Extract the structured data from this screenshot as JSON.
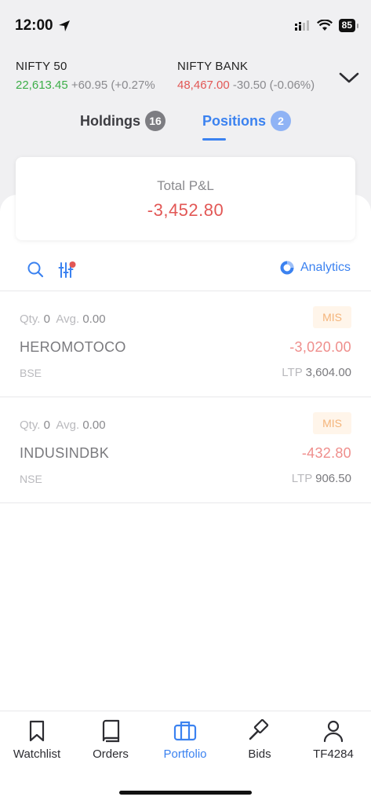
{
  "status_bar": {
    "time": "12:00",
    "battery": "85"
  },
  "indices": [
    {
      "name": "NIFTY 50",
      "value": "22,613.45",
      "change": "+60.95",
      "change_pct": "(+0.27%",
      "direction": "up"
    },
    {
      "name": "NIFTY BANK",
      "value": "48,467.00",
      "change": "-30.50",
      "change_pct": "(-0.06%)",
      "direction": "down"
    }
  ],
  "tabs": [
    {
      "label": "Holdings",
      "count": "16",
      "active": false
    },
    {
      "label": "Positions",
      "count": "2",
      "active": true
    }
  ],
  "pnl": {
    "label": "Total P&L",
    "value": "-3,452.80"
  },
  "toolbar": {
    "analytics_label": "Analytics"
  },
  "positions": [
    {
      "qty_label": "Qty.",
      "qty": "0",
      "avg_label": "Avg.",
      "avg": "0.00",
      "product": "MIS",
      "symbol": "HEROMOTOCO",
      "pnl": "-3,020.00",
      "exchange": "BSE",
      "ltp_label": "LTP",
      "ltp": "3,604.00"
    },
    {
      "qty_label": "Qty.",
      "qty": "0",
      "avg_label": "Avg.",
      "avg": "0.00",
      "product": "MIS",
      "symbol": "INDUSINDBK",
      "pnl": "-432.80",
      "exchange": "NSE",
      "ltp_label": "LTP",
      "ltp": "906.50"
    }
  ],
  "nav": [
    {
      "label": "Watchlist",
      "icon": "bookmark-icon",
      "active": false
    },
    {
      "label": "Orders",
      "icon": "book-icon",
      "active": false
    },
    {
      "label": "Portfolio",
      "icon": "briefcase-icon",
      "active": true
    },
    {
      "label": "Bids",
      "icon": "gavel-icon",
      "active": false
    },
    {
      "label": "TF4284",
      "icon": "user-icon",
      "active": false
    }
  ],
  "colors": {
    "accent": "#3b82f0",
    "profit": "#3cae48",
    "loss": "#e25755",
    "mis_badge": "#f4b47a"
  }
}
